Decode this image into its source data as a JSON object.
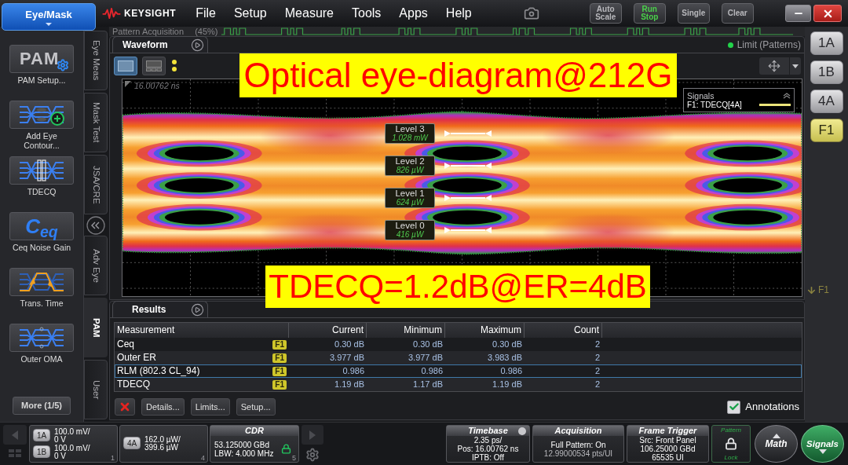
{
  "top_bar": {
    "mode_button": "Eye/Mask",
    "brand": "KEYSIGHT",
    "menu": [
      "File",
      "Setup",
      "Measure",
      "Tools",
      "Apps",
      "Help"
    ],
    "buttons": [
      {
        "lines": [
          "Auto",
          "Scale"
        ],
        "active": false
      },
      {
        "lines": [
          "Run",
          "Stop"
        ],
        "active": true
      },
      {
        "lines": [
          "Single"
        ],
        "active": false
      },
      {
        "lines": [
          "Clear"
        ],
        "active": false
      }
    ]
  },
  "sidebar": {
    "items": [
      {
        "kind": "pam",
        "icon_text": "PAM",
        "lines": [
          "PAM Setup..."
        ]
      },
      {
        "kind": "contour",
        "lines": [
          "Add Eye",
          "Contour..."
        ]
      },
      {
        "kind": "tdecq",
        "lines": [
          "TDECQ"
        ]
      },
      {
        "kind": "ceq",
        "icon_text": "C$_{eq}$",
        "lines": [
          "Ceq Noise Gain"
        ]
      },
      {
        "kind": "transition",
        "lines": [
          "Trans. Time"
        ]
      },
      {
        "kind": "oma",
        "lines": [
          "Outer OMA"
        ]
      }
    ],
    "more_button": "More (1/5)"
  },
  "side_tabs": {
    "upper": [
      {
        "label": "Eye Meas",
        "selected": false
      },
      {
        "label": "Mask Test",
        "selected": false
      },
      {
        "label": "JSA/CRE",
        "selected": false
      }
    ],
    "lower": [
      {
        "label": "Adv Eye",
        "selected": false
      },
      {
        "label": "PAM",
        "selected": true
      },
      {
        "label": "User",
        "selected": false
      }
    ]
  },
  "pattern_acquisition": {
    "label": "Pattern Acquisition",
    "percent": "(45%)"
  },
  "waveform": {
    "tab": "Waveform",
    "view_buttons": [
      {
        "kind": "single",
        "selected": true
      },
      {
        "kind": "tiled",
        "selected": false
      }
    ],
    "limit": "Limit (Patterns)",
    "timestamp": "16.00762 ns",
    "levels": [
      {
        "label": "Level 3",
        "value": "1.028 mW"
      },
      {
        "label": "Level 2",
        "value": "826 µW"
      },
      {
        "label": "Level 1",
        "value": "624 µW"
      },
      {
        "label": "Level 0",
        "value": "416 µW"
      }
    ],
    "legend": {
      "title": "Signals",
      "entries": [
        {
          "label": "F1: TDECQ[4A]"
        }
      ]
    },
    "annotations": {
      "top": "Optical eye-diagram@212G",
      "bottom": "TDECQ=1.2dB@ER=4dB"
    }
  },
  "channels": {
    "buttons": [
      {
        "label": "1A",
        "selected": false
      },
      {
        "label": "1B",
        "selected": false
      },
      {
        "label": "4A",
        "selected": false
      },
      {
        "label": "F1",
        "selected": true
      }
    ],
    "marker": "F1"
  },
  "results": {
    "tab": "Results",
    "columns": [
      "Measurement",
      "Current",
      "Minimum",
      "Maximum",
      "Count"
    ],
    "rows": [
      {
        "measurement": "Ceq",
        "source": "F1",
        "current": "0.30 dB",
        "minimum": "0.30 dB",
        "maximum": "0.30 dB",
        "count": "2",
        "selected": false
      },
      {
        "measurement": "Outer ER",
        "source": "F1",
        "current": "3.977 dB",
        "minimum": "3.977 dB",
        "maximum": "3.983 dB",
        "count": "2",
        "selected": false
      },
      {
        "measurement": "RLM (802.3 CL_94)",
        "source": "F1",
        "current": "0.986",
        "minimum": "0.986",
        "maximum": "0.986",
        "count": "2",
        "selected": true
      },
      {
        "measurement": "TDECQ",
        "source": "F1",
        "current": "1.19 dB",
        "minimum": "1.17 dB",
        "maximum": "1.19 dB",
        "count": "2",
        "selected": false
      }
    ],
    "buttons": [
      "Details...",
      "Limits...",
      "Setup..."
    ],
    "annotations": {
      "label": "Annotations",
      "checked": true
    }
  },
  "status_bar": {
    "channel_groups": [
      {
        "slot": "1",
        "channels": [
          {
            "label": "1A",
            "scale": "100.0 mV/",
            "offset": "0 V"
          },
          {
            "label": "1B",
            "scale": "100.0 mV/",
            "offset": "0 V"
          }
        ]
      },
      {
        "slot": "4",
        "channels": [
          {
            "label": "4A",
            "scale": "162.0 µW/",
            "offset": "399.6 µW"
          }
        ]
      }
    ],
    "cdr": {
      "title": "CDR",
      "rate": "53.125000 GBd",
      "bandwidth": "LBW: 4.000 MHz",
      "slot": "5",
      "locked": true
    },
    "timebase": {
      "title": "Timebase",
      "lines": [
        "2.35 ps/",
        "Pos: 16.00762 ns",
        "IPTB: Off"
      ]
    },
    "acquisition": {
      "title": "Acquisition",
      "lines": [
        "Full Pattern: On",
        "12.99000534 pts/UI"
      ]
    },
    "frame_trigger": {
      "title": "Frame Trigger",
      "lines": [
        "Src: Front Panel",
        "106.25000 GBd",
        "65535 UI"
      ]
    },
    "pattern_lock": {
      "top": "Pattern",
      "bottom": "Lock",
      "locked": true
    },
    "math_button": "Math",
    "signals_button": "Signals"
  }
}
